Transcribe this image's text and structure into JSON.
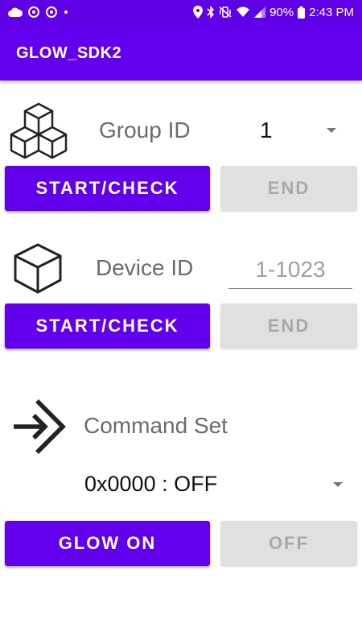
{
  "status_bar": {
    "battery": "90%",
    "time": "2:43 PM",
    "icons": [
      "cloud-icon",
      "sync-icon",
      "sync-icon",
      "dot-icon",
      "location-icon",
      "bluetooth-icon",
      "vibrate-icon",
      "wifi-icon",
      "signal-icon",
      "battery-icon"
    ]
  },
  "app_bar": {
    "title": "GLOW_SDK2"
  },
  "group": {
    "label": "Group ID",
    "selected_value": "1",
    "start_label": "START/CHECK",
    "end_label": "END"
  },
  "device": {
    "label": "Device ID",
    "placeholder": "1-1023",
    "value": "",
    "start_label": "START/CHECK",
    "end_label": "END"
  },
  "command": {
    "label": "Command Set",
    "selected_value": "0x0000 : OFF",
    "on_label": "GLOW ON",
    "off_label": "OFF"
  },
  "colors": {
    "primary": "#6200ee",
    "status_bar": "#5f00e6",
    "disabled_bg": "#e0e0e0",
    "disabled_text": "#a9a9a9",
    "label_text": "#6b6b6b"
  }
}
